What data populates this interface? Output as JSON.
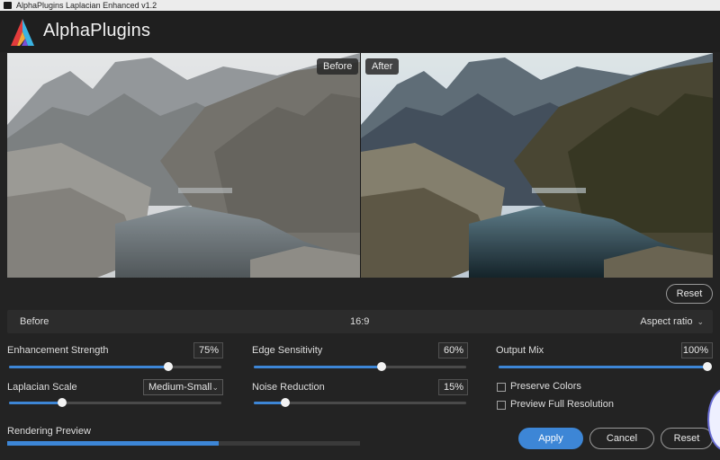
{
  "window": {
    "title": "AlphaPlugins Laplacian Enhanced v1.2"
  },
  "brand": {
    "name": "AlphaPlugins",
    "colors": [
      "#e23b3b",
      "#f2a93b",
      "#3bb3e2",
      "#7a4fd6"
    ]
  },
  "preview": {
    "before_label": "Before",
    "after_label": "After",
    "reset_label": "Reset"
  },
  "ratio_bar": {
    "compare_label": "Before",
    "value": "16:9",
    "select_label": "Aspect ratio"
  },
  "controls": {
    "enhancement_strength": {
      "label": "Enhancement Strength",
      "value": "75%",
      "level": 0.75
    },
    "laplacian_scale": {
      "label": "Laplacian Scale",
      "selected": "Medium-Small",
      "level": 0.25
    },
    "edge_sensitivity": {
      "label": "Edge Sensitivity",
      "value": "60%",
      "level": 0.6
    },
    "noise_reduction": {
      "label": "Noise Reduction",
      "value": "15%",
      "level": 0.15
    },
    "output_mix": {
      "label": "Output Mix",
      "value": "100%",
      "level": 1.0
    },
    "preserve_colors": {
      "label": "Preserve Colors",
      "checked": false
    },
    "preview_full_resolution": {
      "label": "Preview Full Resolution",
      "checked": false
    }
  },
  "rendering": {
    "label": "Rendering Preview",
    "progress": 0.6
  },
  "actions": {
    "apply": "Apply",
    "cancel": "Cancel",
    "reset": "Reset"
  },
  "accent_color": "#3d86d6"
}
